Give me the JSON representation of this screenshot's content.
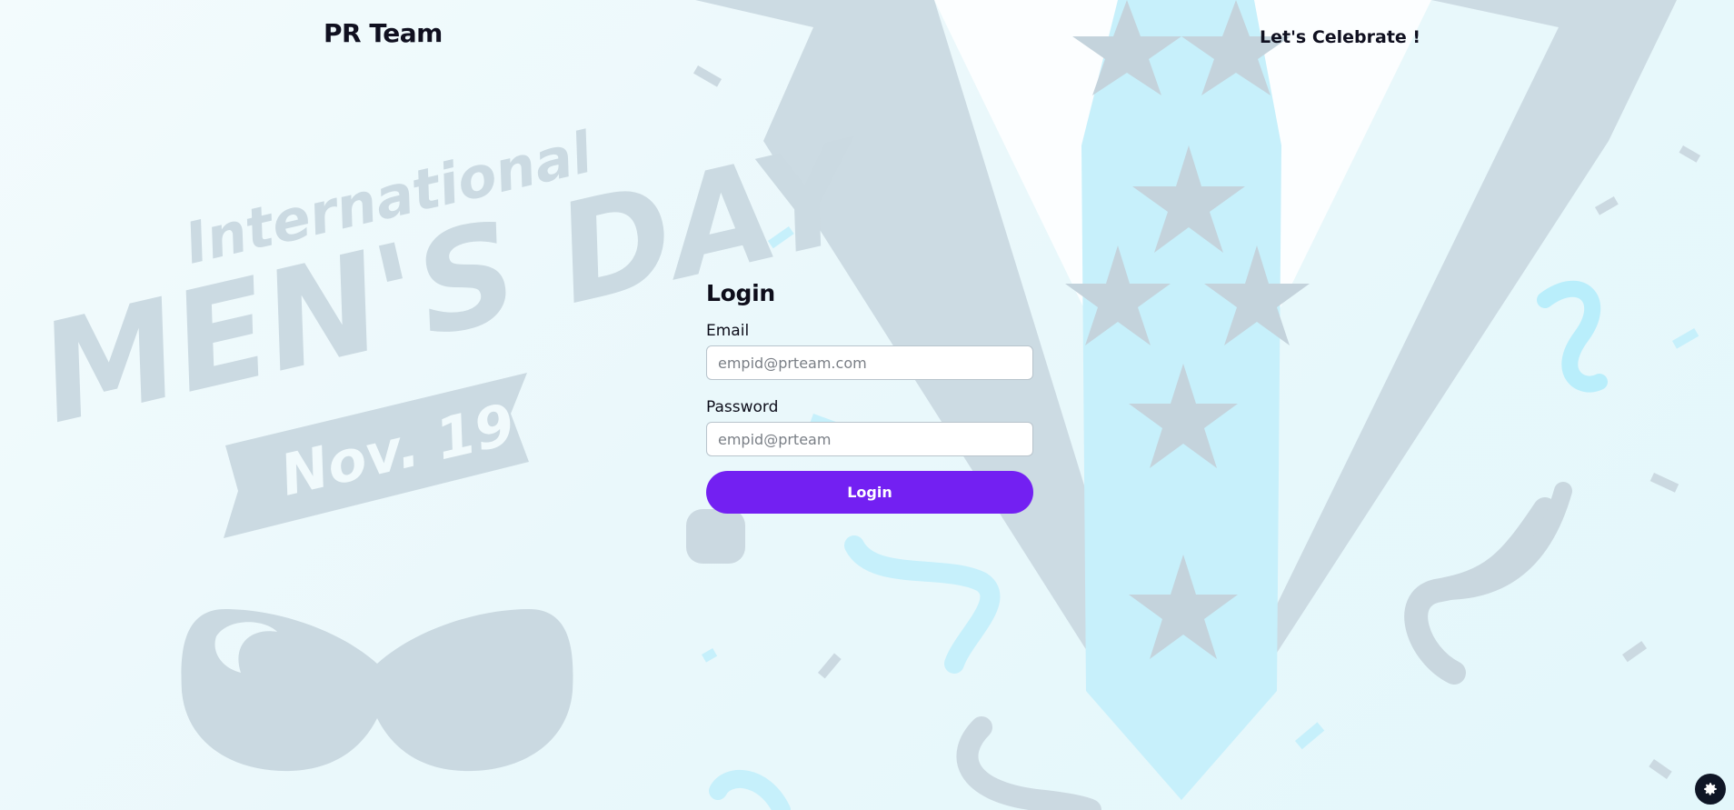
{
  "header": {
    "brand": "PR Team",
    "celebrate_link": "Let's Celebrate !"
  },
  "background": {
    "line1": "International",
    "line2": "MEN'S DAY",
    "line3": "Nov. 19"
  },
  "login": {
    "title": "Login",
    "email_label": "Email",
    "email_placeholder": "empid@prteam.com",
    "password_label": "Password",
    "password_placeholder": "empid@prteam",
    "submit_label": "Login"
  },
  "colors": {
    "accent": "#7320f2",
    "art": "#cbdbe3",
    "tie": "#c5f0fb"
  },
  "icons": {
    "settings": "gear-icon"
  }
}
